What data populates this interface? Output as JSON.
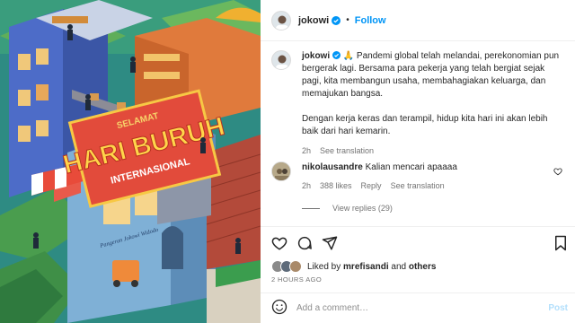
{
  "post": {
    "username": "jokowi",
    "separator": "•",
    "follow_label": "Follow",
    "caption": {
      "username": "jokowi",
      "paragraph1": "🙏 Pandemi global telah melandai, perekonomian pun bergerak lagi. Bersama para pekerja yang telah bergiat sejak pagi, kita membangun usaha, membahagiakan keluarga, dan memajukan bangsa.",
      "paragraph2": "Dengan kerja keras dan terampil, hidup kita hari ini akan lebih baik dari hari kemarin.",
      "age": "2h",
      "see_translation": "See translation"
    },
    "comment": {
      "username": "nikolausandre",
      "text": "Kalian mencari apaaaa",
      "age": "2h",
      "likes": "388 likes",
      "reply": "Reply",
      "see_translation": "See translation"
    },
    "view_replies": "View replies (29)",
    "liked_by_prefix": "Liked by",
    "liked_by_user": "mrefisandi",
    "liked_by_and": "and",
    "liked_by_others": "others",
    "timestamp": "2 HOURS AGO",
    "add_comment_placeholder": "Add a comment…",
    "post_label": "Post"
  },
  "image_text": {
    "line1": "SELAMAT",
    "line2": "HARI BURUH",
    "line3": "INTERNASIONAL",
    "signature": "Pangeran Jokowi Widodo"
  },
  "icons": {
    "verified": "verified-badge-icon",
    "like": "heart-icon",
    "comment": "comment-bubble-icon",
    "share": "paper-plane-icon",
    "save": "bookmark-icon",
    "emoji": "smiley-icon"
  },
  "colors": {
    "accent": "#0095f6",
    "muted": "#737373",
    "post_disabled": "#b2dffc"
  }
}
